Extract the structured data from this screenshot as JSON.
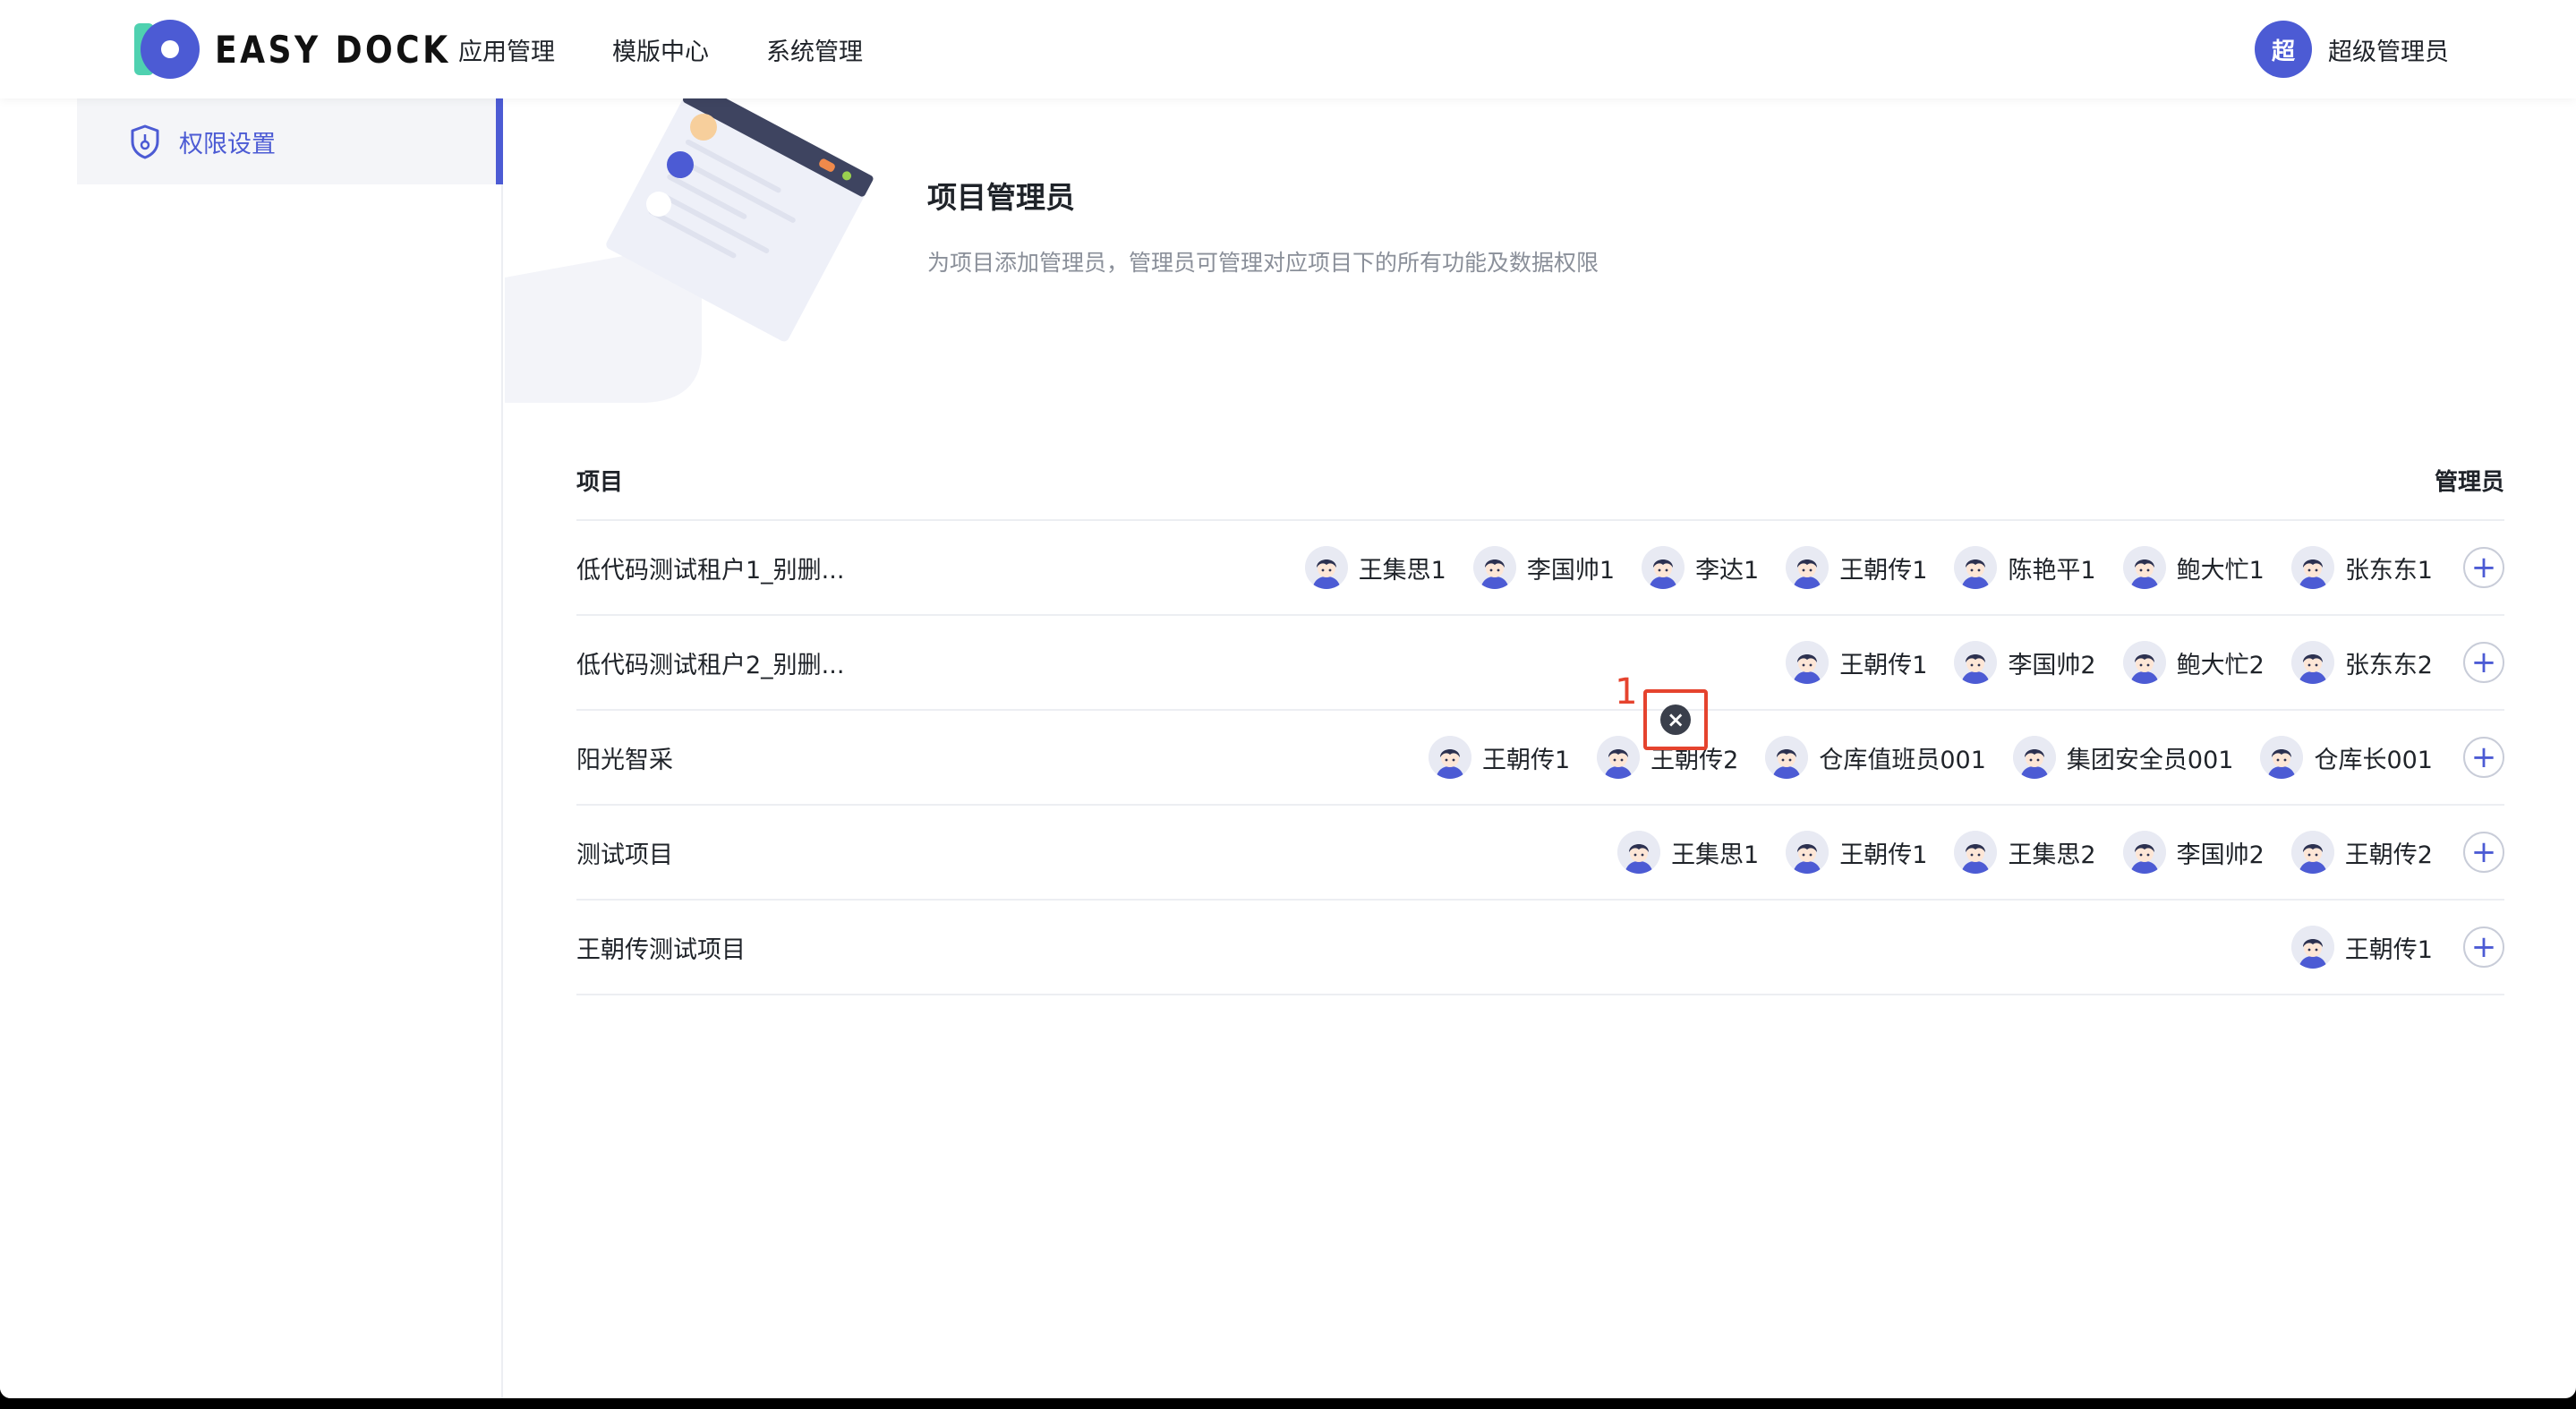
{
  "header": {
    "logo_text": "EASY DOCK",
    "nav": [
      "应用管理",
      "模版中心",
      "系统管理"
    ],
    "user": {
      "avatar_text": "超",
      "name": "超级管理员"
    }
  },
  "sidebar": {
    "items": [
      {
        "label": "权限设置",
        "icon": "shield-icon",
        "active": true
      }
    ]
  },
  "main": {
    "title": "项目管理员",
    "description": "为项目添加管理员，管理员可管理对应项目下的所有功能及数据权限",
    "table": {
      "headers": {
        "project": "项目",
        "admins": "管理员"
      },
      "rows": [
        {
          "project": "低代码测试租户1_别删...",
          "admins": [
            "王集思1",
            "李国帅1",
            "李达1",
            "王朝传1",
            "陈艳平1",
            "鲍大忙1",
            "张东东1"
          ]
        },
        {
          "project": "低代码测试租户2_别删...",
          "admins": [
            "王朝传1",
            "李国帅2",
            "鲍大忙2",
            "张东东2"
          ]
        },
        {
          "project": "阳光智采",
          "admins": [
            "王朝传1",
            "王朝传2",
            "仓库值班员001",
            "集团安全员001",
            "仓库长001"
          ]
        },
        {
          "project": "测试项目",
          "admins": [
            "王集思1",
            "王朝传1",
            "王集思2",
            "李国帅2",
            "王朝传2"
          ]
        },
        {
          "project": "王朝传测试项目",
          "admins": [
            "王朝传1"
          ]
        }
      ]
    },
    "annotation": {
      "number": "1",
      "target": "remove-admin-button"
    }
  },
  "colors": {
    "accent": "#4c5bd4",
    "highlight": "#e5432e"
  }
}
